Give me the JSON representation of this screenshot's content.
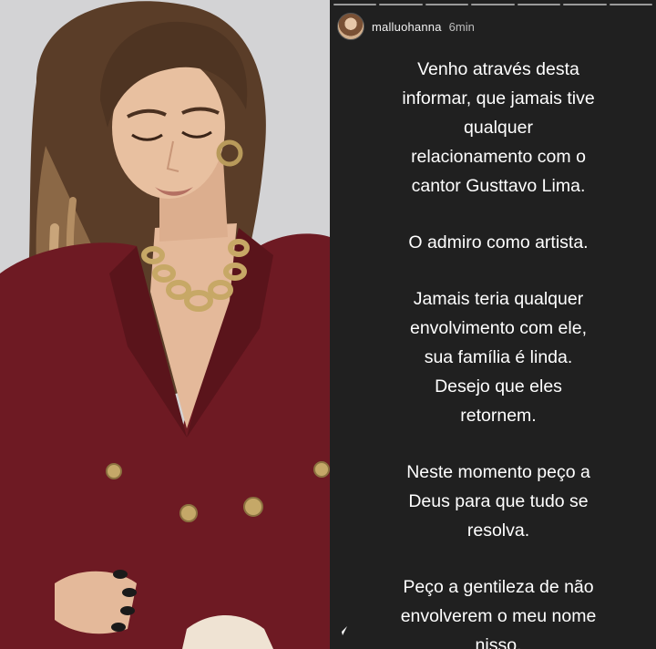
{
  "story": {
    "username": "malluohanna",
    "time_ago": "6min",
    "segments": 7,
    "paragraphs": [
      "Venho através desta\ninformar, que jamais tive\nqualquer\nrelacionamento com o\ncantor Gusttavo Lima.",
      "O admiro como artista.",
      "Jamais teria qualquer\nenvolvimento com ele,\nsua família é linda.\nDesejo que eles\nretornem.",
      "Neste momento peço a\nDeus para que tudo se\nresolva.",
      "Peço a gentileza de não\nenvolverem o meu nome\nnisso."
    ]
  },
  "colors": {
    "story_background": "#202020",
    "text": "#ffffff",
    "blazer": "#6e1a23",
    "photo_background": "#d2d2d4"
  },
  "icons": {
    "avatar": "profile-avatar",
    "send": "send-arrow-icon"
  }
}
